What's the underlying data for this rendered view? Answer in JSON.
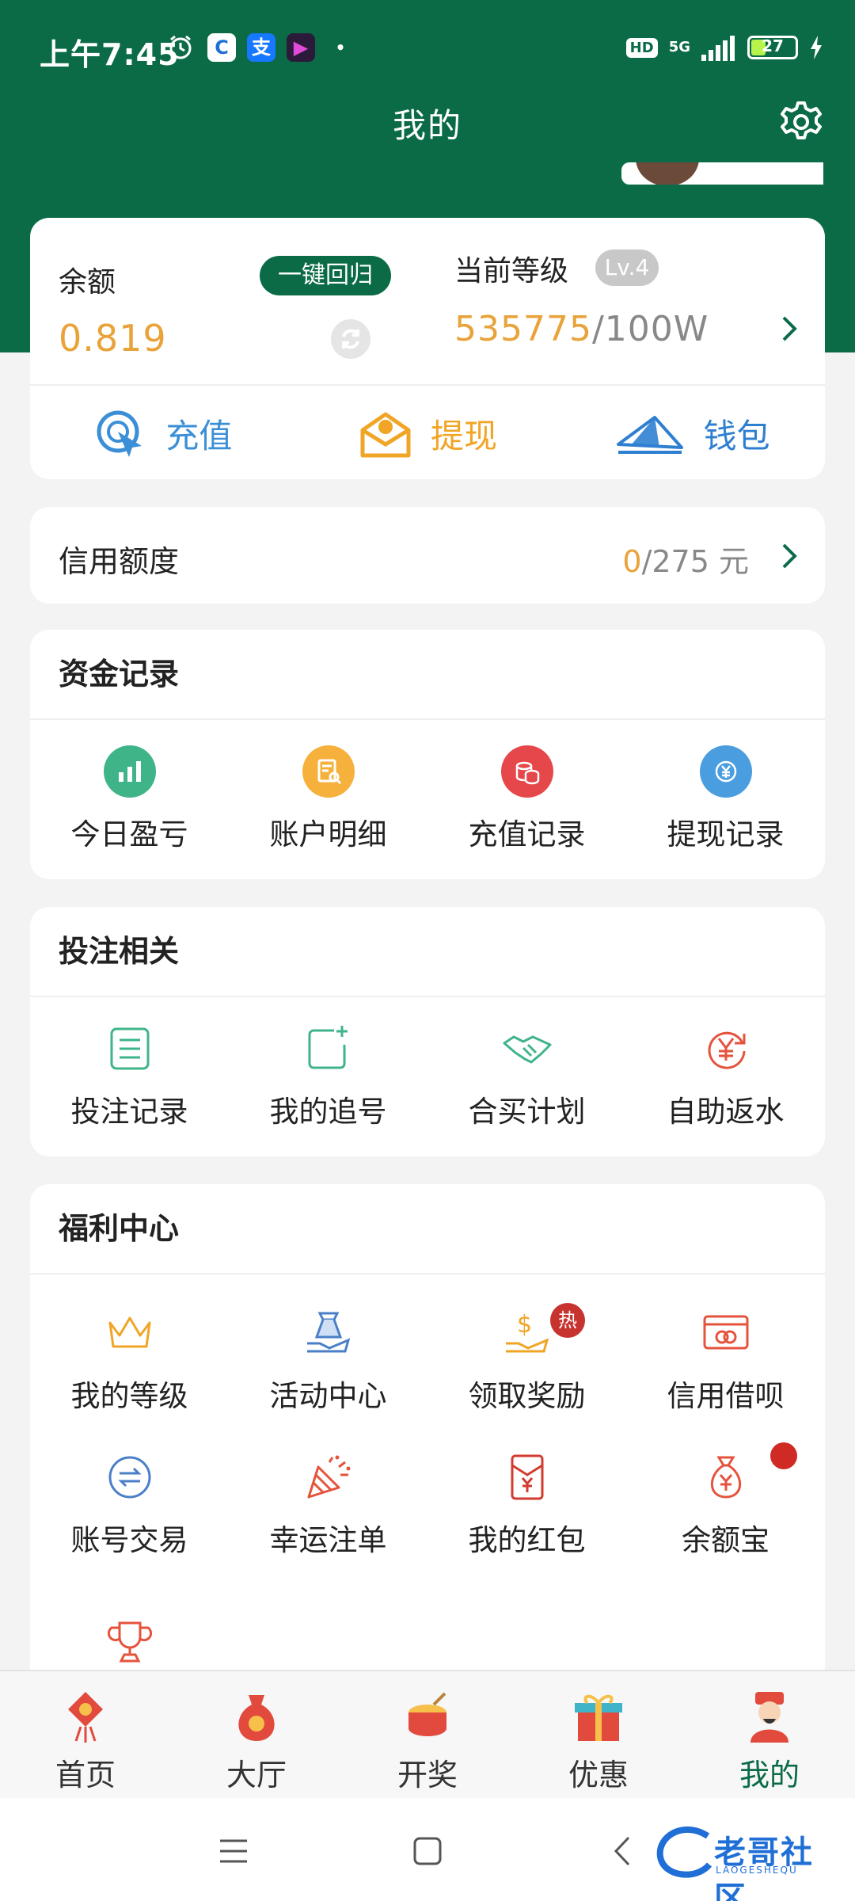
{
  "status_bar": {
    "time": "上午7:45",
    "app_icons": [
      "alarm-icon",
      "c-app-icon",
      "alipay-icon",
      "video-app-icon"
    ],
    "hd": "HD",
    "network": "5G",
    "battery": "27"
  },
  "header": {
    "title": "我的",
    "settings_icon": "gear-icon"
  },
  "balance": {
    "label": "余额",
    "value": "0.819",
    "recall_button": "一键回归",
    "level_label": "当前等级",
    "level_badge": "Lv.4",
    "level_current": "535775",
    "level_target": "/100W"
  },
  "actions": [
    {
      "label": "充值",
      "icon": "recharge-icon",
      "color": "#3a8fd6"
    },
    {
      "label": "提现",
      "icon": "withdraw-icon",
      "color": "#f0a526"
    },
    {
      "label": "钱包",
      "icon": "wallet-icon",
      "color": "#2f7fd1"
    }
  ],
  "credit": {
    "title": "信用额度",
    "used": "0",
    "total": "/275 元"
  },
  "fund_records": {
    "title": "资金记录",
    "items": [
      {
        "label": "今日盈亏",
        "icon": "chart-icon",
        "color": "#3fb489"
      },
      {
        "label": "账户明细",
        "icon": "statement-icon",
        "color": "#f6b13c"
      },
      {
        "label": "充值记录",
        "icon": "coins-icon",
        "color": "#e5474a"
      },
      {
        "label": "提现记录",
        "icon": "yen-transfer-icon",
        "color": "#4a9ee0"
      }
    ]
  },
  "betting": {
    "title": "投注相关",
    "items": [
      {
        "label": "投注记录",
        "icon": "list-icon"
      },
      {
        "label": "我的追号",
        "icon": "add-square-icon"
      },
      {
        "label": "合买计划",
        "icon": "handshake-icon"
      },
      {
        "label": "自助返水",
        "icon": "yen-refresh-icon"
      }
    ]
  },
  "welfare": {
    "title": "福利中心",
    "hot_badge": "热",
    "items": [
      {
        "label": "我的等级",
        "icon": "crown-icon"
      },
      {
        "label": "活动中心",
        "icon": "gift-hand-icon"
      },
      {
        "label": "领取奖励",
        "icon": "dollar-hand-icon"
      },
      {
        "label": "信用借呗",
        "icon": "card-icon"
      },
      {
        "label": "账号交易",
        "icon": "exchange-icon"
      },
      {
        "label": "幸运注单",
        "icon": "party-popper-icon"
      },
      {
        "label": "我的红包",
        "icon": "red-envelope-icon"
      },
      {
        "label": "余额宝",
        "icon": "money-bag-icon"
      },
      {
        "label": "",
        "icon": "trophy-icon"
      }
    ]
  },
  "tabbar": [
    {
      "label": "首页",
      "icon": "knot-icon"
    },
    {
      "label": "大厅",
      "icon": "lucky-bag-icon"
    },
    {
      "label": "开奖",
      "icon": "drum-icon"
    },
    {
      "label": "优惠",
      "icon": "gift-box-icon"
    },
    {
      "label": "我的",
      "icon": "god-of-wealth-icon",
      "active": true
    }
  ],
  "watermark": {
    "text": "老哥社区",
    "sub": "LAOGESHEQU"
  },
  "colors": {
    "primary": "#0b6b47",
    "accent": "#e8a33a"
  }
}
